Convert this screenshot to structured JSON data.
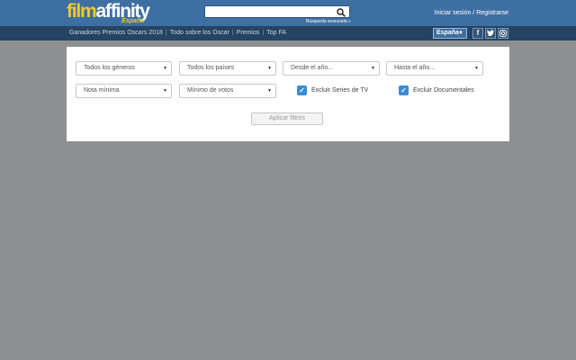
{
  "logo": {
    "brand_part1": "film",
    "brand_part2": "affinity",
    "region": "España"
  },
  "search": {
    "placeholder": "",
    "advanced_link": "Búsqueda avanzada »"
  },
  "account": {
    "login": "Iniciar sesión / Registrarse"
  },
  "nav": {
    "links": [
      "Ganadores Premios Oscars 2018",
      "Todo sobre los Oscar",
      "Premios",
      "Top FA"
    ]
  },
  "country_selector": {
    "value": "España"
  },
  "social": [
    "facebook-icon",
    "twitter-icon",
    "instagram-icon"
  ],
  "filters": {
    "genre": "Todos los géneros",
    "country": "Todos los países",
    "year_from": "Desde el año...",
    "year_to": "Hasta el año...",
    "min_rating": "Nota mínima",
    "min_votes": "Mínimo de votos",
    "exclude_tv_series": {
      "label": "Excluir Series de TV",
      "checked": true
    },
    "exclude_documentaries": {
      "label": "Excluir Documentales",
      "checked": true
    },
    "apply_button": "Aplicar filtros"
  },
  "colors": {
    "header": "#3e6fa3",
    "subnav": "#254463",
    "logo_yellow": "#f3c823",
    "checkbox": "#3a8bd6",
    "background": "#8e8f91"
  }
}
